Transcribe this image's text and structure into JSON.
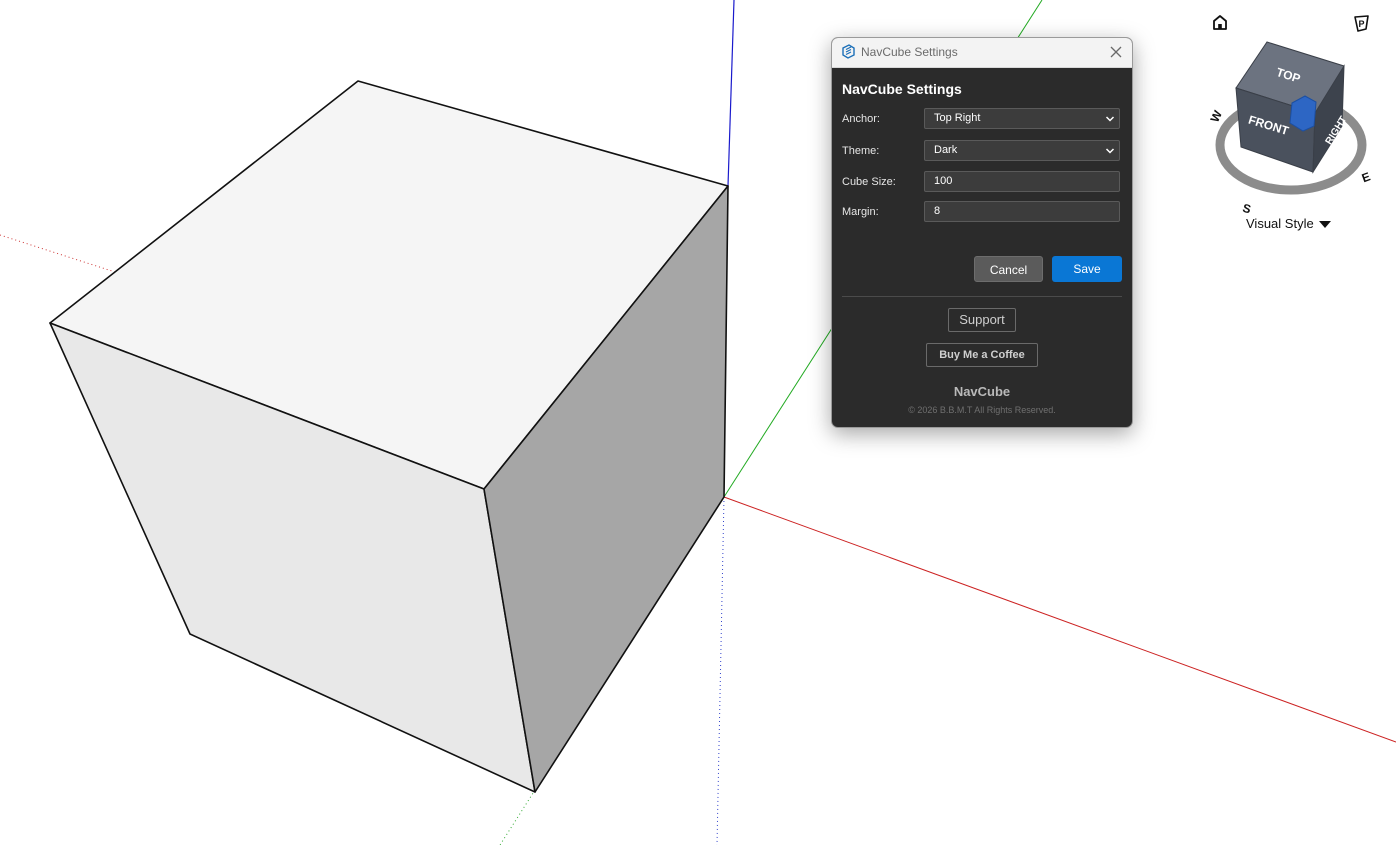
{
  "dialog": {
    "window_title": "NavCube Settings",
    "heading": "NavCube Settings",
    "fields": {
      "anchor": {
        "label": "Anchor:",
        "value": "Top Right"
      },
      "theme": {
        "label": "Theme:",
        "value": "Dark"
      },
      "cube_size": {
        "label": "Cube Size:",
        "value": "100"
      },
      "margin": {
        "label": "Margin:",
        "value": "8"
      }
    },
    "buttons": {
      "cancel": "Cancel",
      "save": "Save",
      "support": "Support",
      "coffee": "Buy Me a Coffee"
    },
    "brand": "NavCube",
    "copyright": "© 2026 B.B.M.T All Rights Reserved."
  },
  "navcube": {
    "faces": {
      "top": "TOP",
      "front": "FRONT",
      "right": "RIGHT"
    },
    "compass": {
      "w": "W",
      "e": "E",
      "s": "S"
    },
    "visual_style_label": "Visual Style",
    "home_icon": "home-icon",
    "perspective_icon": "perspective-icon"
  },
  "colors": {
    "accent": "#0a77d5",
    "dialog_bg": "#2b2b2b",
    "axis_red": "#cc2222",
    "axis_green": "#22aa22",
    "axis_blue": "#1a1acc"
  }
}
